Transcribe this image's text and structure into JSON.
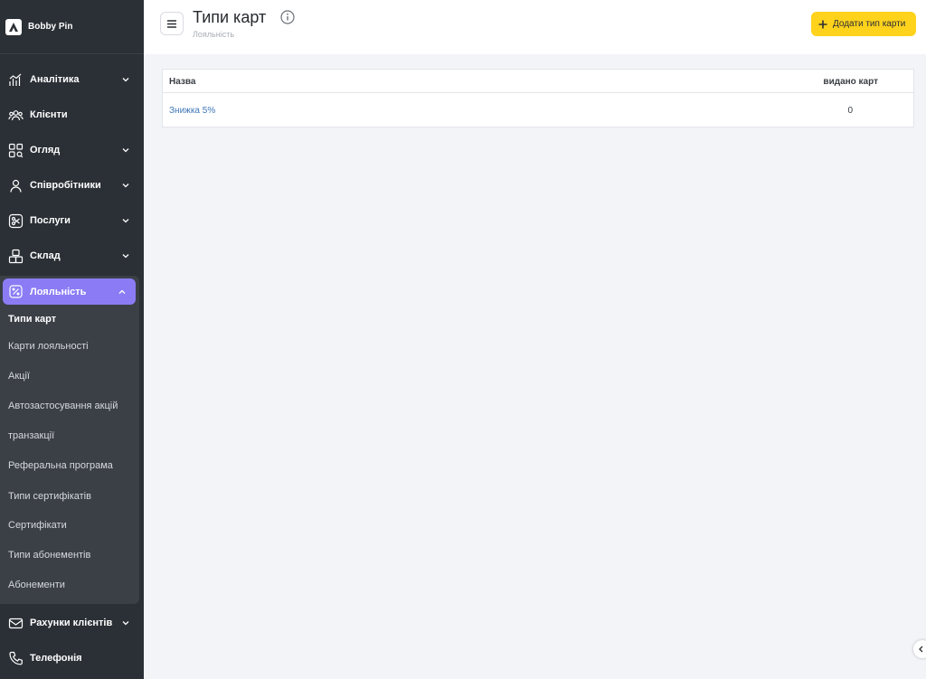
{
  "brand": {
    "name": "Bobby Pin"
  },
  "sidebar": {
    "items": [
      {
        "label": "Аналітика",
        "icon": "analytics-icon",
        "has_chevron": true
      },
      {
        "label": "Клієнти",
        "icon": "clients-icon",
        "has_chevron": false
      },
      {
        "label": "Огляд",
        "icon": "overview-icon",
        "has_chevron": true
      },
      {
        "label": "Співробітники",
        "icon": "employee-icon",
        "has_chevron": true
      },
      {
        "label": "Послуги",
        "icon": "scissors-icon",
        "has_chevron": true
      },
      {
        "label": "Склад",
        "icon": "boxes-icon",
        "has_chevron": true
      }
    ],
    "loyalty": {
      "label": "Лояльність",
      "icon": "percent-icon",
      "expanded": true,
      "accent": "#8b7cf5",
      "subitems": [
        {
          "label": "Типи карт",
          "active": true
        },
        {
          "label": "Карти лояльності",
          "active": false
        },
        {
          "label": "Акції",
          "active": false
        },
        {
          "label": "Автозастосування акцій",
          "active": false
        },
        {
          "label": "транзакції",
          "active": false
        },
        {
          "label": "Реферальна програма",
          "active": false
        },
        {
          "label": "Типи сертифікатів",
          "active": false
        },
        {
          "label": "Сертифікати",
          "active": false
        },
        {
          "label": "Типи абонементів",
          "active": false
        },
        {
          "label": "Абонементи",
          "active": false
        }
      ]
    },
    "bottom_items": [
      {
        "label": "Рахунки клієнтів",
        "icon": "envelope-icon",
        "has_chevron": true
      },
      {
        "label": "Телефонія",
        "icon": "phone-icon",
        "has_chevron": false
      }
    ]
  },
  "header": {
    "title": "Типи карт",
    "breadcrumb": "Лояльність",
    "add_button": "Додати тип карти",
    "add_button_color": "#ffd21c"
  },
  "table": {
    "columns": [
      "Назва",
      "видано карт"
    ],
    "rows": [
      {
        "name": "Знижка 5%",
        "count": "0"
      }
    ]
  }
}
